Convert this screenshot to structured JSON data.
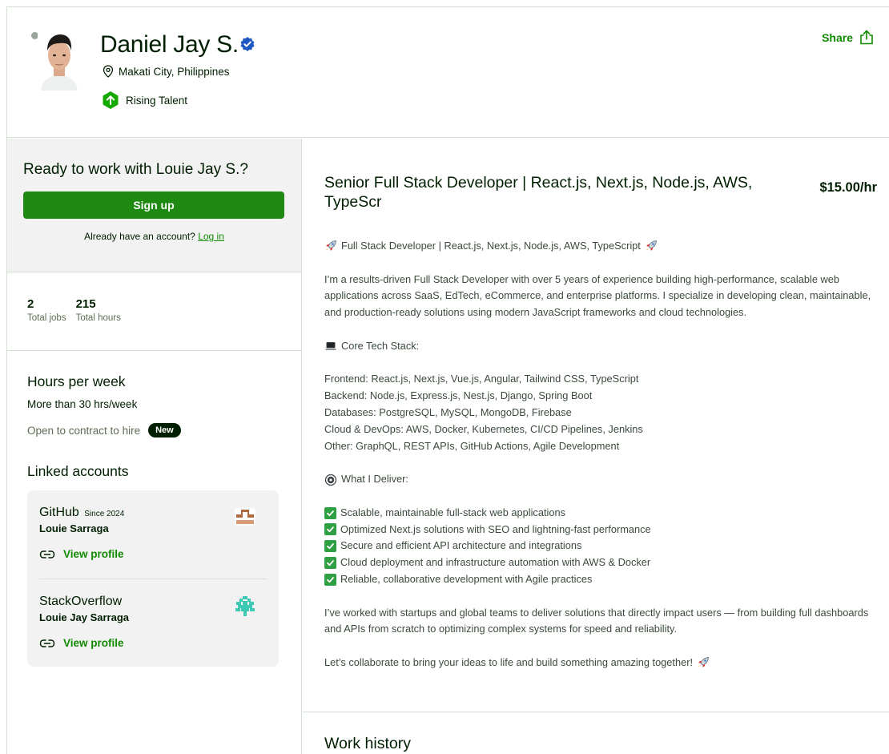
{
  "profile": {
    "name": "Daniel Jay S.",
    "location": "Makati City, Philippines",
    "badge": "Rising Talent",
    "share_label": "Share"
  },
  "sidebar": {
    "cta_title": "Ready to work with Louie Jay S.?",
    "signup_label": "Sign up",
    "login_prompt": "Already have an account?",
    "login_label": "Log in",
    "stats": [
      {
        "value": "2",
        "label": "Total jobs"
      },
      {
        "value": "215",
        "label": "Total hours"
      }
    ],
    "hours_heading": "Hours per week",
    "hours_value": "More than 30 hrs/week",
    "contract_text": "Open to contract to hire",
    "new_badge": "New",
    "linked_heading": "Linked accounts",
    "accounts": [
      {
        "name": "GitHub",
        "since": "Since 2024",
        "user": "Louie Sarraga",
        "link": "View profile",
        "icon": "github-avatar-icon"
      },
      {
        "name": "StackOverflow",
        "since": "",
        "user": "Louie Jay Sarraga",
        "link": "View profile",
        "icon": "stackoverflow-avatar-icon"
      }
    ]
  },
  "main": {
    "title": "Senior Full Stack Developer | React.js, Next.js, Node.js, AWS, TypeScr",
    "rate": "$15.00/hr",
    "intro": "Full Stack Developer | React.js, Next.js, Node.js, AWS, TypeScript",
    "para1": "I’m a results-driven Full Stack Developer with over 5 years of experience building high-performance, scalable web applications across SaaS, EdTech, eCommerce, and enterprise platforms. I specialize in developing clean, maintainable, and production-ready solutions using modern JavaScript frameworks and cloud technologies.",
    "stack_heading": "Core Tech Stack:",
    "stack": [
      "Frontend: React.js, Next.js, Vue.js, Angular, Tailwind CSS, TypeScript",
      "Backend: Node.js, Express.js, Nest.js, Django, Spring Boot",
      "Databases: PostgreSQL, MySQL, MongoDB, Firebase",
      "Cloud & DevOps: AWS, Docker, Kubernetes, CI/CD Pipelines, Jenkins",
      "Other: GraphQL, REST APIs, GitHub Actions, Agile Development"
    ],
    "deliver_heading": "What I Deliver:",
    "deliver": [
      "Scalable, maintainable full-stack web applications",
      "Optimized Next.js solutions with SEO and lightning-fast performance",
      "Secure and efficient API architecture and integrations",
      "Cloud deployment and infrastructure automation with AWS & Docker",
      "Reliable, collaborative development with Agile practices"
    ],
    "para2": "I’ve worked with startups and global teams to deliver solutions that directly impact users — from building full dashboards and APIs from scratch to optimizing complex systems for speed and reliability.",
    "closing": "Let’s collaborate to bring your ideas to life and build something amazing together!",
    "work_history_heading": "Work history"
  },
  "colors": {
    "brand_green": "#108a00",
    "button_green": "#1e8a12",
    "text": "#001e00"
  }
}
